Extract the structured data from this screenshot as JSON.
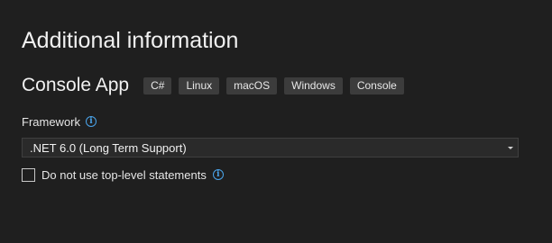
{
  "page": {
    "title": "Additional information"
  },
  "template": {
    "name": "Console App",
    "tags": [
      "C#",
      "Linux",
      "macOS",
      "Windows",
      "Console"
    ]
  },
  "framework": {
    "label": "Framework",
    "info_icon": "info-icon",
    "selected": ".NET 6.0 (Long Term Support)",
    "dropdown_icon": "chevron-down-icon"
  },
  "top_level_statements": {
    "label": "Do not use top-level statements",
    "checked": false,
    "info_icon": "info-icon"
  },
  "colors": {
    "background": "#1f1f1f",
    "tag_background": "#3c3c3c",
    "info_accent": "#4aa4ea"
  }
}
